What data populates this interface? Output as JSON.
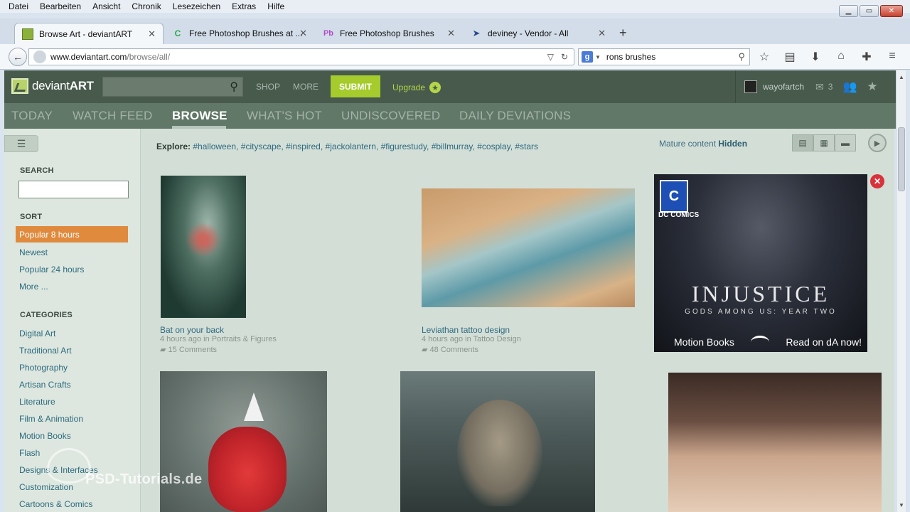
{
  "menu": [
    "Datei",
    "Bearbeiten",
    "Ansicht",
    "Chronik",
    "Lesezeichen",
    "Extras",
    "Hilfe"
  ],
  "tabs": [
    {
      "label": "Browse Art - deviantART",
      "icon": "deviantart-favicon-icon"
    },
    {
      "label": "Free Photoshop Brushes at ...",
      "icon": "brushes-favicon-icon"
    },
    {
      "label": "Free Photoshop Brushes",
      "icon": "pb-favicon-icon"
    },
    {
      "label": "deviney - Vendor - All",
      "icon": "vendor-favicon-icon"
    }
  ],
  "nav": {
    "url_host": "www.deviantart.com",
    "url_path": "/browse/all/",
    "search_value": "rons brushes"
  },
  "header": {
    "logo_light": "deviant",
    "logo_bold": "ART",
    "shop": "SHOP",
    "more": "MORE",
    "submit": "SUBMIT",
    "upgrade": "Upgrade",
    "username": "wayofartch",
    "message_count": "3"
  },
  "sitenav": [
    "TODAY",
    "WATCH FEED",
    "BROWSE",
    "WHAT'S HOT",
    "UNDISCOVERED",
    "DAILY DEVIATIONS"
  ],
  "sidebar": {
    "search_heading": "SEARCH",
    "sort_heading": "SORT",
    "sort_items": [
      "Popular 8 hours",
      "Newest",
      "Popular 24 hours",
      "More ..."
    ],
    "categories_heading": "CATEGORIES",
    "categories": [
      "Digital Art",
      "Traditional Art",
      "Photography",
      "Artisan Crafts",
      "Literature",
      "Film & Animation",
      "Motion Books",
      "Flash",
      "Designs & Interfaces",
      "Customization",
      "Cartoons & Comics"
    ]
  },
  "explore": {
    "label": "Explore:",
    "tags": [
      "#halloween,",
      "#cityscape,",
      "#inspired,",
      "#jackolantern,",
      "#figurestudy,",
      "#billmurray,",
      "#cosplay,",
      "#stars"
    ]
  },
  "mature": {
    "label": "Mature content",
    "value": "Hidden"
  },
  "deviations": [
    {
      "title": "Bat on your back",
      "time": "4 hours ago in",
      "category": "Portraits & Figures",
      "comments": "15 Comments"
    },
    {
      "title": "Leviathan tattoo design",
      "time": "4 hours ago in",
      "category": "Tattoo Design",
      "comments": "48 Comments"
    }
  ],
  "ad": {
    "brand": "DC COMICS",
    "title": "INJUSTICE",
    "subtitle": "GODS AMONG US: YEAR TWO",
    "left_cta": "Motion Books",
    "right_cta": "Read on dA now!"
  },
  "watermark": "PSD-Tutorials.de",
  "colors": {
    "header_bg": "#475a4c",
    "nav_bg": "#617767",
    "submit": "#a5cc2c",
    "sort_selected": "#e08a3e",
    "link": "#2d6a7e"
  }
}
